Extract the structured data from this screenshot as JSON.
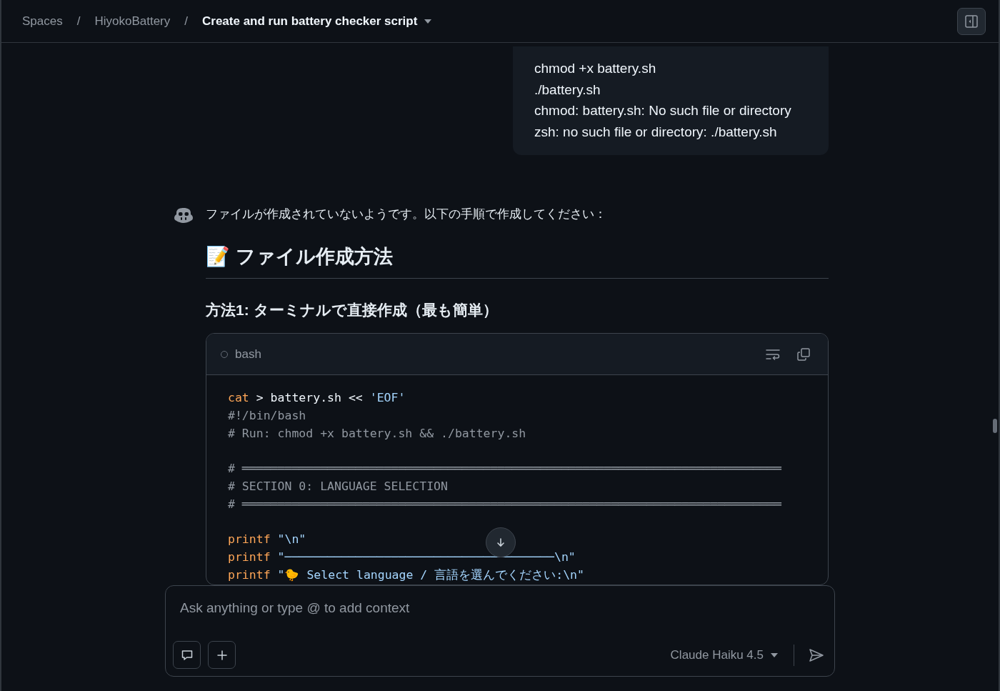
{
  "breadcrumbs": [
    {
      "label": "Spaces",
      "current": false
    },
    {
      "label": "HiyokoBattery",
      "current": false
    },
    {
      "label": "Create and run battery checker script",
      "current": true
    }
  ],
  "separator": "/",
  "user_message": {
    "lines": [
      "chmod +x battery.sh",
      "./battery.sh",
      "chmod: battery.sh: No such file or directory",
      "zsh: no such file or directory: ./battery.sh"
    ]
  },
  "assistant": {
    "intro": "ファイルが作成されていないようです。以下の手順で作成してください：",
    "heading": "📝 ファイル作成方法",
    "subheading": "方法1: ターミナルで直接作成（最も簡単）",
    "code_block": {
      "language": "bash",
      "lines": [
        {
          "kind": "code",
          "tokens": [
            {
              "kind": "keyword",
              "text": "cat"
            },
            {
              "kind": "plain",
              "text": " > battery.sh << "
            },
            {
              "kind": "string",
              "text": "'EOF'"
            }
          ]
        },
        {
          "kind": "code",
          "tokens": [
            {
              "kind": "comment",
              "text": "#!/bin/bash"
            }
          ]
        },
        {
          "kind": "code",
          "tokens": [
            {
              "kind": "comment",
              "text": "# Run: chmod +x battery.sh && ./battery.sh"
            }
          ]
        },
        {
          "kind": "blank"
        },
        {
          "kind": "code",
          "tokens": [
            {
              "kind": "comment",
              "text": "# ════════════════════════════════════════════════════════════════════════════"
            }
          ]
        },
        {
          "kind": "code",
          "tokens": [
            {
              "kind": "comment",
              "text": "# SECTION 0: LANGUAGE SELECTION"
            }
          ]
        },
        {
          "kind": "code",
          "tokens": [
            {
              "kind": "comment",
              "text": "# ════════════════════════════════════════════════════════════════════════════"
            }
          ]
        },
        {
          "kind": "blank"
        },
        {
          "kind": "code",
          "tokens": [
            {
              "kind": "keyword",
              "text": "printf"
            },
            {
              "kind": "string",
              "text": " \"\\n\""
            }
          ]
        },
        {
          "kind": "code",
          "tokens": [
            {
              "kind": "keyword",
              "text": "printf"
            },
            {
              "kind": "string",
              "text": " \"──────────────────────────────────────\\n\""
            }
          ]
        },
        {
          "kind": "code",
          "tokens": [
            {
              "kind": "keyword",
              "text": "printf"
            },
            {
              "kind": "string",
              "text": " \"🐤 Select language / 言語を選んでください:\\n\""
            }
          ]
        }
      ]
    }
  },
  "composer": {
    "placeholder": "Ask anything or type @ to add context",
    "model": "Claude Haiku 4.5"
  }
}
